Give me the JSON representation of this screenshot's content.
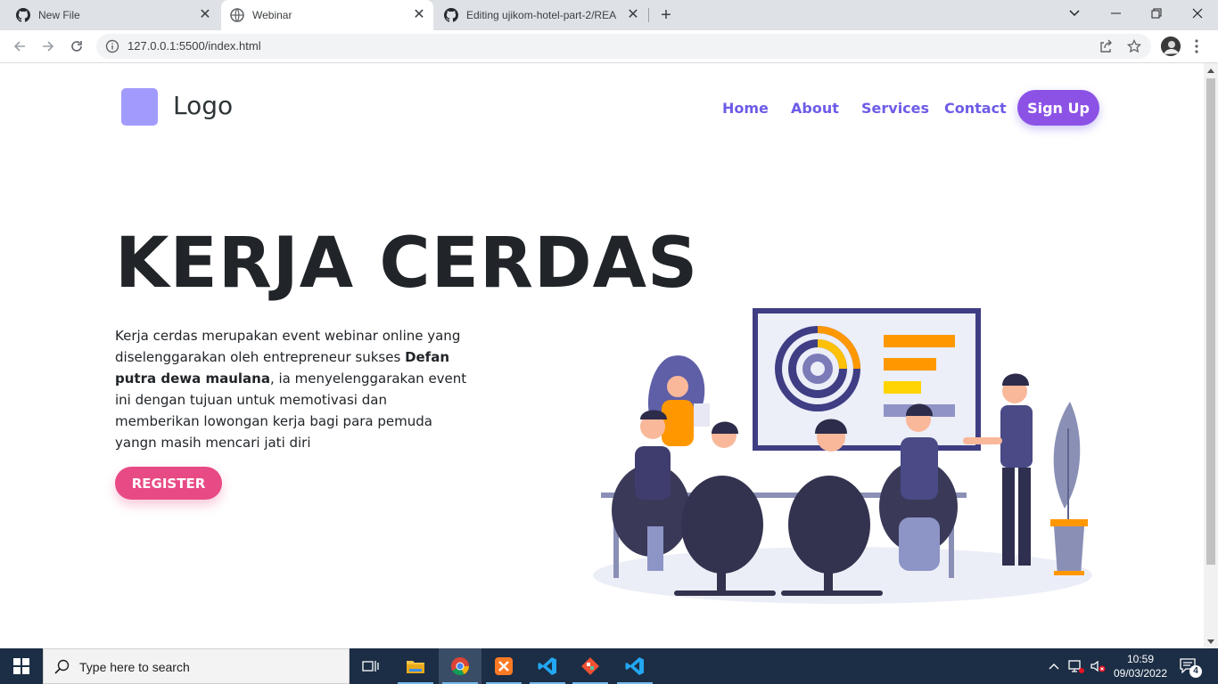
{
  "browser": {
    "tabs": [
      {
        "title": "New File",
        "icon": "github-icon",
        "active": false
      },
      {
        "title": "Webinar",
        "icon": "globe-icon",
        "active": true
      },
      {
        "title": "Editing ujikom-hotel-part-2/REA",
        "icon": "github-icon",
        "active": false
      }
    ],
    "new_tab": "+",
    "url": "127.0.0.1:5500/index.html"
  },
  "page": {
    "logo_text": "Logo",
    "nav": [
      "Home",
      "About",
      "Services",
      "Contact"
    ],
    "signup_label": "Sign Up",
    "hero_title": "KERJA CERDAS",
    "hero_desc_1": "Kerja cerdas merupakan event webinar online yang diselenggarakan oleh entrepreneur sukses ",
    "hero_desc_bold": "Defan putra dewa maulana",
    "hero_desc_2": ", ia menyelenggarakan event ini dengan tujuan untuk memotivasi dan memberikan lowongan kerja bagi para pemuda yangn masih mencari jati diri",
    "register_label": "REGISTER",
    "colors": {
      "accent": "#6c5ce7",
      "signup": "#8c52e6",
      "register": "#e84a85",
      "logo_box": "#a29bfe"
    }
  },
  "taskbar": {
    "search_placeholder": "Type here to search",
    "apps": [
      "task-view-icon",
      "file-explorer-icon",
      "chrome-icon",
      "xampp-icon",
      "vscode-icon",
      "git-icon",
      "vscode-icon"
    ],
    "time": "10:59",
    "date": "09/03/2022",
    "notification_count": "4"
  }
}
